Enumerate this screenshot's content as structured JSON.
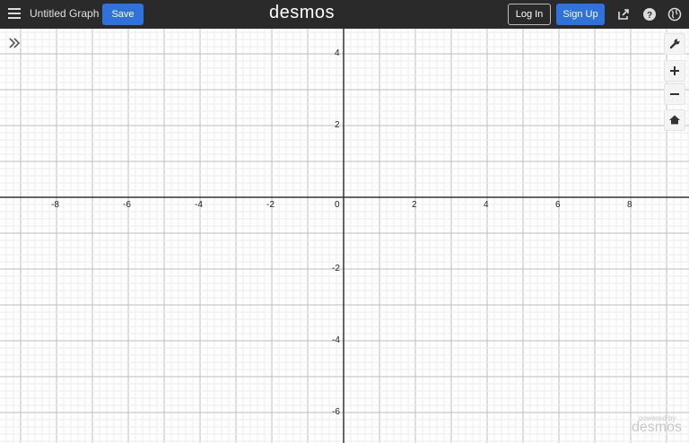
{
  "header": {
    "title": "Untitled Graph",
    "save_label": "Save",
    "logo": "desmos",
    "login_label": "Log In",
    "signup_label": "Sign Up",
    "icons": [
      "menu-icon",
      "share-icon",
      "help-icon",
      "globe-icon"
    ],
    "accent": "#2f72dc",
    "bar_color": "#2a2a2a"
  },
  "graph": {
    "x_ticks": [
      "-8",
      "-6",
      "-4",
      "-2",
      "2",
      "4",
      "6",
      "8"
    ],
    "y_ticks_pos": [
      "4",
      "2"
    ],
    "y_ticks_neg": [
      "-2",
      "-4",
      "-6"
    ],
    "origin": "0",
    "grid": true
  },
  "controls": {
    "icons": [
      "wrench-icon",
      "zoom-in-icon",
      "zoom-out-icon",
      "home-icon"
    ]
  },
  "watermark": {
    "powered": "powered by",
    "brand": "desmos"
  }
}
